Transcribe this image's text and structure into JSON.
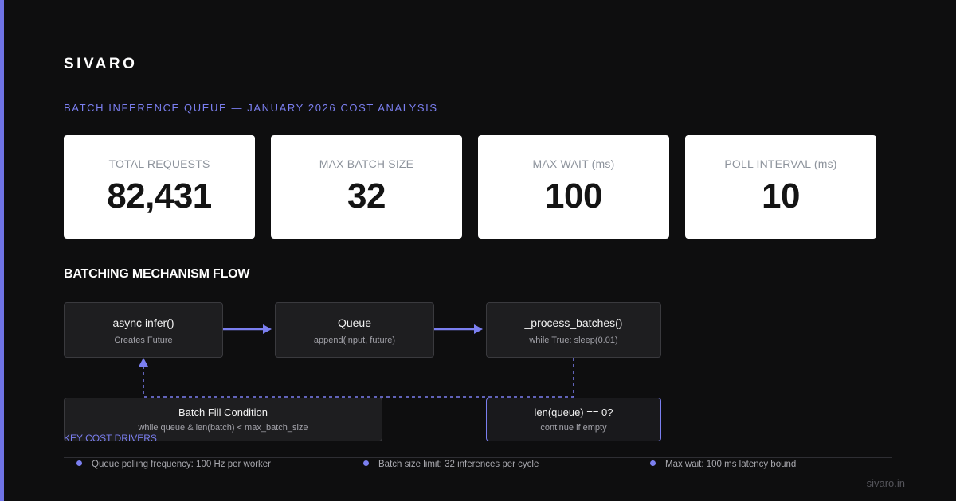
{
  "brand": "SIVARO",
  "subtitle": "BATCH INFERENCE QUEUE — JANUARY 2026 COST ANALYSIS",
  "stats": [
    {
      "label": "TOTAL REQUESTS",
      "value": "82,431"
    },
    {
      "label": "MAX BATCH SIZE",
      "value": "32"
    },
    {
      "label": "MAX WAIT (ms)",
      "value": "100"
    },
    {
      "label": "POLL INTERVAL (ms)",
      "value": "10"
    }
  ],
  "flow": {
    "title": "BATCHING MECHANISM FLOW",
    "nodes": {
      "infer": {
        "title": "async infer()",
        "sub": "Creates Future"
      },
      "queue": {
        "title": "Queue",
        "sub": "append(input, future)"
      },
      "process": {
        "title": "_process_batches()",
        "sub": "while True: sleep(0.01)"
      },
      "fill": {
        "title": "Batch Fill Condition",
        "sub": "while queue & len(batch) < max_batch_size"
      },
      "empty": {
        "title": "len(queue) == 0?",
        "sub": "continue if empty"
      }
    }
  },
  "cost_drivers": {
    "label": "KEY COST DRIVERS",
    "items": [
      "Queue polling frequency: 100 Hz per worker",
      "Batch size limit: 32 inferences per cycle",
      "Max wait: 100 ms latency bound"
    ]
  },
  "footer": "sivaro.in",
  "colors": {
    "accent": "#7b7ff0",
    "background": "#0e0e0f",
    "card": "#ffffff",
    "node": "#1e1e20"
  }
}
